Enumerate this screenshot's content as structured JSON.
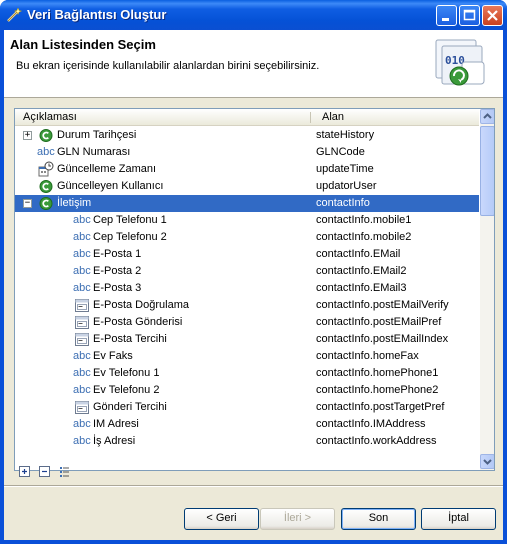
{
  "window": {
    "title": "Veri Bağlantısı Oluştur"
  },
  "header": {
    "title": "Alan Listesinden Seçim",
    "description": "Bu ekran içerisinde kullanılabilir alanlardan birini seçebilirsiniz.",
    "image_text": "010"
  },
  "table": {
    "columns": [
      "Açıklaması",
      "Alan"
    ],
    "rows": [
      {
        "name": "Durum Tarihçesi",
        "field": "stateHistory",
        "icon": "green-circle-c-icon",
        "expander": "+",
        "level": 0
      },
      {
        "name": "GLN Numarası",
        "field": "GLNCode",
        "icon": "abc-text-icon",
        "level": 0
      },
      {
        "name": "Güncelleme Zamanı",
        "field": "updateTime",
        "icon": "calendar-clock-icon",
        "level": 0
      },
      {
        "name": "Güncelleyen Kullanıcı",
        "field": "updatorUser",
        "icon": "green-circle-c-icon",
        "level": 0
      },
      {
        "name": "İletişim",
        "field": "contactInfo",
        "icon": "green-circle-c-icon",
        "expander": "−",
        "level": 0,
        "selected": true
      },
      {
        "name": "Cep Telefonu 1",
        "field": "contactInfo.mobile1",
        "icon": "abc-text-icon",
        "level": 1
      },
      {
        "name": "Cep Telefonu 2",
        "field": "contactInfo.mobile2",
        "icon": "abc-text-icon",
        "level": 1
      },
      {
        "name": "E-Posta 1",
        "field": "contactInfo.EMail",
        "icon": "abc-text-icon",
        "level": 1
      },
      {
        "name": "E-Posta 2",
        "field": "contactInfo.EMail2",
        "icon": "abc-text-icon",
        "level": 1
      },
      {
        "name": "E-Posta 3",
        "field": "contactInfo.EMail3",
        "icon": "abc-text-icon",
        "level": 1
      },
      {
        "name": "E-Posta Doğrulama",
        "field": "contactInfo.postEMailVerify",
        "icon": "form-field-icon",
        "level": 1
      },
      {
        "name": "E-Posta Gönderisi",
        "field": "contactInfo.postEMailPref",
        "icon": "form-field-icon",
        "level": 1
      },
      {
        "name": "E-Posta Tercihi",
        "field": "contactInfo.postEMailIndex",
        "icon": "form-field-icon",
        "level": 1
      },
      {
        "name": "Ev Faks",
        "field": "contactInfo.homeFax",
        "icon": "abc-text-icon",
        "level": 1
      },
      {
        "name": "Ev Telefonu 1",
        "field": "contactInfo.homePhone1",
        "icon": "abc-text-icon",
        "level": 1
      },
      {
        "name": "Ev Telefonu 2",
        "field": "contactInfo.homePhone2",
        "icon": "abc-text-icon",
        "level": 1
      },
      {
        "name": "Gönderi Tercihi",
        "field": "contactInfo.postTargetPref",
        "icon": "form-field-icon",
        "level": 1
      },
      {
        "name": "IM Adresi",
        "field": "contactInfo.IMAddress",
        "icon": "abc-text-icon",
        "level": 1
      },
      {
        "name": "İş Adresi",
        "field": "contactInfo.workAddress",
        "icon": "abc-text-icon",
        "level": 1
      }
    ]
  },
  "tools": {
    "expand_all": "expand-all-icon",
    "collapse_all": "collapse-all-icon",
    "flat_list": "list-icon"
  },
  "buttons": {
    "back": "< Geri",
    "next": "İleri >",
    "finish": "Son",
    "cancel": "İptal"
  },
  "colors": {
    "selection": "#316ac5",
    "titlebar": "#0a50d8",
    "dialog_bg": "#ece9d8",
    "green_icon": "#3a9a3a",
    "abc_blue": "#3d6fb3"
  }
}
